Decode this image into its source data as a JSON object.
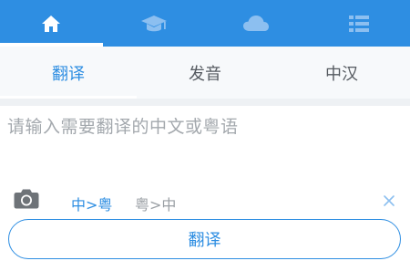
{
  "topbar": {
    "icons": [
      "home-icon",
      "graduation-cap-icon",
      "cloud-icon",
      "list-icon"
    ],
    "active_index": 0
  },
  "subtabs": {
    "items": [
      {
        "label": "翻译"
      },
      {
        "label": "发音"
      },
      {
        "label": "中汉"
      }
    ],
    "active_index": 0
  },
  "input": {
    "placeholder": "请输入需要翻译的中文或粤语",
    "value": ""
  },
  "direction": {
    "option_1": "中>粤",
    "option_2": "粤>中",
    "selected": "中>粤"
  },
  "translate_button": {
    "label": "翻译"
  },
  "colors": {
    "accent": "#2e8ee2",
    "inactive_icon": "#8cbff0",
    "subtab_bg": "#f7f9fb"
  }
}
